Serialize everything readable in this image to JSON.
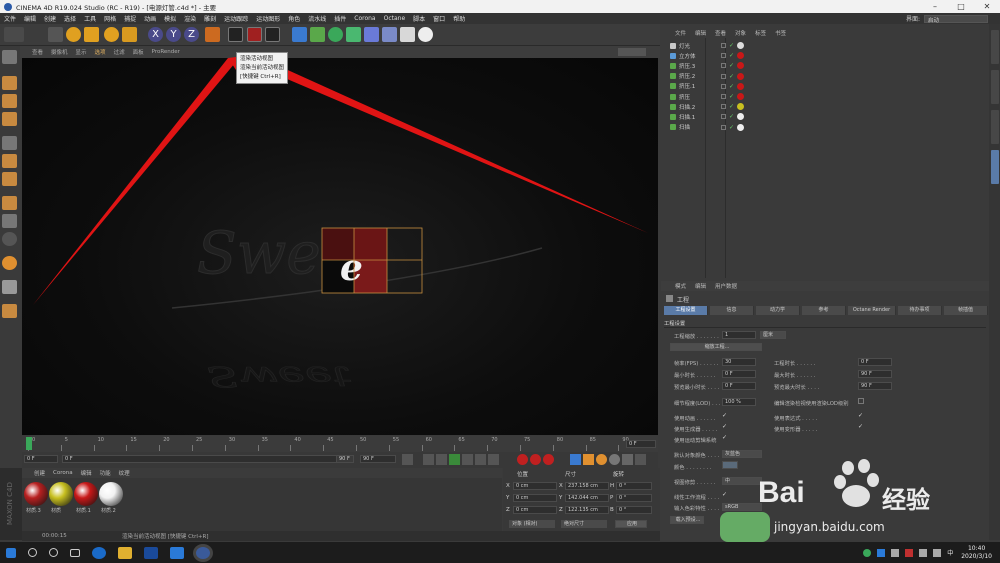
{
  "window": {
    "title": "CINEMA 4D R19.024 Studio (RC - R19) - [电源灯管.c4d *] - 主要"
  },
  "menu": [
    "文件",
    "编辑",
    "创建",
    "选择",
    "工具",
    "网格",
    "捕捉",
    "动画",
    "模拟",
    "渲染",
    "雕刻",
    "运动跟踪",
    "运动图形",
    "角色",
    "流水线",
    "插件",
    "Corona",
    "Octane",
    "脚本",
    "窗口",
    "帮助"
  ],
  "layout": {
    "label": "界面:",
    "value": "启动"
  },
  "viewport": {
    "menu": [
      "查看",
      "摄像机",
      "显示",
      "选项",
      "过滤",
      "面板",
      "ProRender"
    ],
    "menu_highlight": "选项"
  },
  "tooltip": {
    "line1": "渲染活动视图",
    "line2": "渲染当前活动视图",
    "line3": "[快捷键 Ctrl+R]"
  },
  "timeline": {
    "ticks": [
      "0",
      "5",
      "10",
      "15",
      "20",
      "25",
      "30",
      "35",
      "40",
      "45",
      "50",
      "55",
      "60",
      "65",
      "70",
      "75",
      "80",
      "85",
      "90"
    ],
    "end_field": "0 F"
  },
  "transport": {
    "start": "0 F",
    "cur": "0 F",
    "end": "90 F",
    "max": "90 F"
  },
  "materials": {
    "menu": [
      "创建",
      "Corona",
      "编辑",
      "功能",
      "纹理"
    ],
    "items": [
      {
        "label": "材质.3",
        "color": "#b82020"
      },
      {
        "label": "材质",
        "color": "#c8c020"
      },
      {
        "label": "材质.1",
        "color": "#c81818"
      },
      {
        "label": "材质.2",
        "color": "#f2f2f2"
      }
    ]
  },
  "coords": {
    "headers": [
      "位置",
      "尺寸",
      "旋转"
    ],
    "rows": [
      {
        "axis": "X",
        "pos": "0 cm",
        "size": "237.158 cm",
        "rlabel": "H",
        "rot": "0 °"
      },
      {
        "axis": "Y",
        "pos": "0 cm",
        "size": "142.044 cm",
        "rlabel": "P",
        "rot": "0 °"
      },
      {
        "axis": "Z",
        "pos": "0 cm",
        "size": "122.135 cm",
        "rlabel": "B",
        "rot": "0 °"
      }
    ],
    "mode": "对象 (相对)",
    "size_mode": "绝对尺寸",
    "apply": "应用"
  },
  "status": {
    "time": "00:00:15",
    "text": "渲染当前活动视图 [快捷键 Ctrl+R]"
  },
  "objects": {
    "menu": [
      "文件",
      "编辑",
      "查看",
      "对象",
      "标签",
      "书签"
    ],
    "rows": [
      {
        "name": "灯光",
        "icon": "#c9c9c9"
      },
      {
        "name": "立方体",
        "icon": "#5a9ad8"
      },
      {
        "name": "挤压.3",
        "icon": "#5aa84a"
      },
      {
        "name": "挤压.2",
        "icon": "#5aa84a"
      },
      {
        "name": "挤压.1",
        "icon": "#5aa84a"
      },
      {
        "name": "挤压",
        "icon": "#5aa84a"
      },
      {
        "name": "扫描.2",
        "icon": "#5aa84a"
      },
      {
        "name": "扫描.1",
        "icon": "#5aa84a"
      },
      {
        "name": "扫描",
        "icon": "#5aa84a"
      }
    ]
  },
  "attributes": {
    "menu": [
      "模式",
      "编辑",
      "用户数据"
    ],
    "heading": "工程",
    "tabs": [
      "工程设置",
      "信息",
      "动力学",
      "参考",
      "Octane Render",
      "待办事项",
      "帧插值"
    ],
    "section": "工程设置",
    "scale_label": "工程缩放 . . . . . . .",
    "scale_val": "1",
    "scale_unit": "厘米",
    "scale_btn": "缩放工程...",
    "fps_label": "帧率(FPS) . . . . . .",
    "fps_val": "30",
    "min_label": "最小时长 . . . . . .",
    "min_val": "0 F",
    "pmin_label": "预览最小时长 . . . .",
    "pmin_val": "0 F",
    "lod_label": "细节程度(LOD) . . .",
    "lod_val": "100 %",
    "plen_label": "工程时长 . . . . . .",
    "plen_val": "0 F",
    "max_label": "最大时长 . . . . . .",
    "max_val": "90 F",
    "pmax_label": "预览最大时长 . . . .",
    "pmax_val": "90 F",
    "lod_render": "编辑渲染检视使用渲染LOD级别",
    "use_anim": "使用动画 . . . . . .",
    "use_expr": "使用表达式 . . . . .",
    "use_gen": "使用生成器 . . . . .",
    "use_deform": "使用变形器 . . . . .",
    "use_motion": "使用运动剪辑系统",
    "default_color_label": "默认对象颜色 . . . .",
    "default_color_val": "灰蓝色",
    "color_label": "颜色 . . . . . . . .",
    "view_label": "视图修剪 . . . . . .",
    "view_val": "中",
    "linear_label": "线性工作流程 . . . .",
    "input_label": "输入色彩特性 . . . .",
    "input_val": "sRGB",
    "load_btn": "载入预设..."
  },
  "taskbar": {
    "time": "10:40",
    "date": "2020/3/10",
    "lang": "中"
  },
  "watermark": {
    "brand": "Bai",
    "brand2": "经验",
    "url": "jingyan.baidu.com"
  }
}
